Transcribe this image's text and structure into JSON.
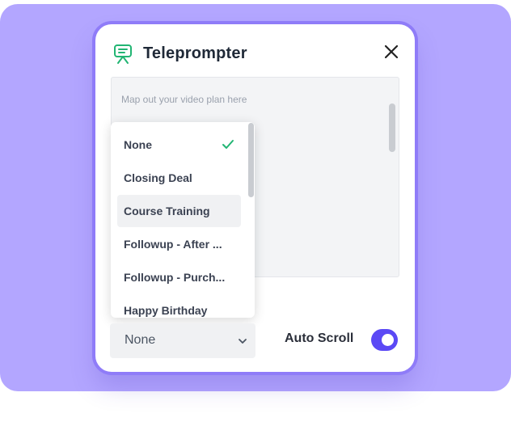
{
  "app": {
    "title": "Teleprompter"
  },
  "editor": {
    "placeholder": "Map out your video plan here"
  },
  "dropdown": {
    "options": [
      {
        "label": "None",
        "selected": true
      },
      {
        "label": "Closing Deal",
        "selected": false
      },
      {
        "label": "Course Training",
        "selected": false,
        "hovered": true
      },
      {
        "label": "Followup - After ...",
        "selected": false
      },
      {
        "label": "Followup - Purch...",
        "selected": false
      },
      {
        "label": "Happy Birthday",
        "selected": false
      }
    ]
  },
  "select": {
    "value": "None"
  },
  "auto_scroll": {
    "label": "Auto Scroll",
    "enabled": true
  },
  "colors": {
    "accent": "#5b49f5",
    "backdrop": "#b3a6ff",
    "icon_green": "#22b573"
  }
}
